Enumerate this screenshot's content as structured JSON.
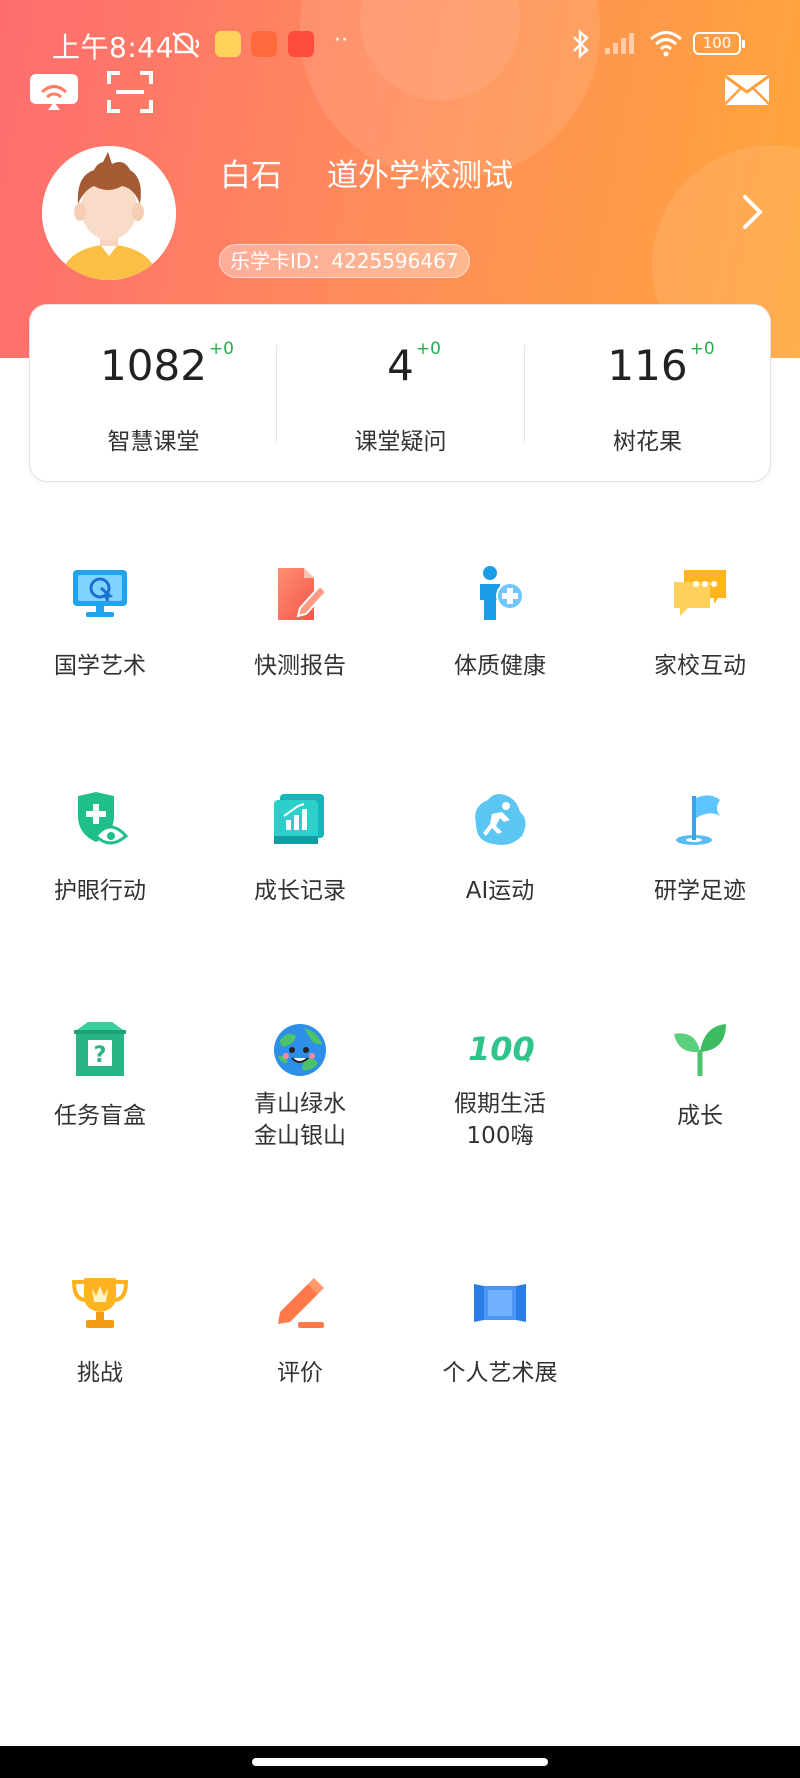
{
  "status_bar": {
    "time": "上午8:44",
    "battery": "100"
  },
  "profile": {
    "name": "白石",
    "school": "道外学校测试",
    "card_id": "乐学卡ID：4225596467"
  },
  "stats": [
    {
      "value": "1082",
      "delta": "+0",
      "label": "智慧课堂"
    },
    {
      "value": "4",
      "delta": "+0",
      "label": "课堂疑问"
    },
    {
      "value": "116",
      "delta": "+0",
      "label": "树花果"
    }
  ],
  "grid": [
    {
      "label": "国学艺术",
      "icon": "monitor-icon"
    },
    {
      "label": "快测报告",
      "icon": "report-icon"
    },
    {
      "label": "体质健康",
      "icon": "health-icon"
    },
    {
      "label": "家校互动",
      "icon": "chat-icon"
    },
    {
      "label": "护眼行动",
      "icon": "eye-shield-icon"
    },
    {
      "label": "成长记录",
      "icon": "growth-record-icon"
    },
    {
      "label": "AI运动",
      "icon": "ai-sport-icon"
    },
    {
      "label": "研学足迹",
      "icon": "flag-icon"
    },
    {
      "label": "任务盲盒",
      "icon": "mystery-box-icon"
    },
    {
      "label": "青山绿水\n金山银山",
      "icon": "earth-icon"
    },
    {
      "label": "假期生活\n100嗨",
      "icon": "hundred-icon"
    },
    {
      "label": "成长",
      "icon": "sprout-icon"
    },
    {
      "label": "挑战",
      "icon": "trophy-icon"
    },
    {
      "label": "评价",
      "icon": "pencil-icon"
    },
    {
      "label": "个人艺术展",
      "icon": "gallery-icon"
    }
  ],
  "colors": {
    "header_start": "#fe6c6f",
    "header_end": "#ffa63a",
    "delta_green": "#22b14c"
  }
}
